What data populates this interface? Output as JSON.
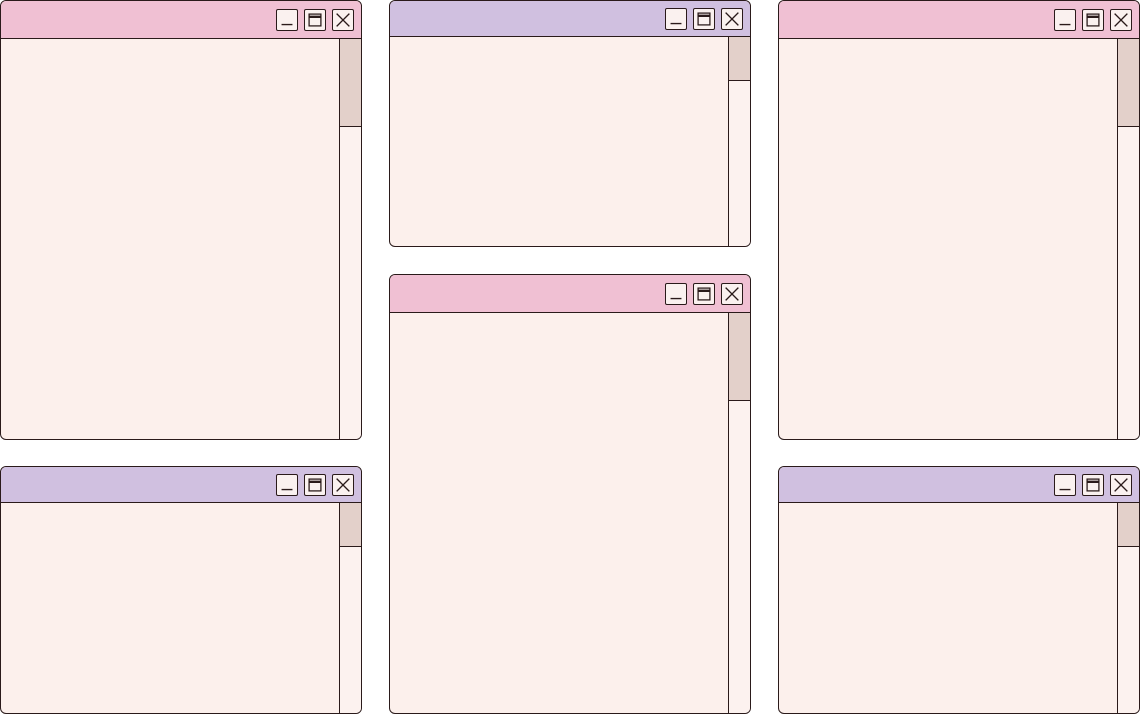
{
  "colors": {
    "titlebar_pink": "#f0c0d3",
    "titlebar_lavender": "#d0c0e0",
    "window_body": "#fcf0ec",
    "scroll_thumb": "#e3d0ca",
    "outline": "#2a1a1a"
  },
  "icons": {
    "minimize": "minimize-icon",
    "maximize": "maximize-icon",
    "close": "close-icon"
  },
  "windows": [
    {
      "id": "top-left",
      "titlebar_color": "pink",
      "scroll_thumb_fraction": 0.22
    },
    {
      "id": "top-center",
      "titlebar_color": "lavender",
      "scroll_thumb_fraction": 0.21
    },
    {
      "id": "top-right",
      "titlebar_color": "pink",
      "scroll_thumb_fraction": 0.22
    },
    {
      "id": "bottom-left",
      "titlebar_color": "lavender",
      "scroll_thumb_fraction": 0.21
    },
    {
      "id": "middle-center",
      "titlebar_color": "pink",
      "scroll_thumb_fraction": 0.22
    },
    {
      "id": "bottom-right",
      "titlebar_color": "lavender",
      "scroll_thumb_fraction": 0.21
    }
  ]
}
